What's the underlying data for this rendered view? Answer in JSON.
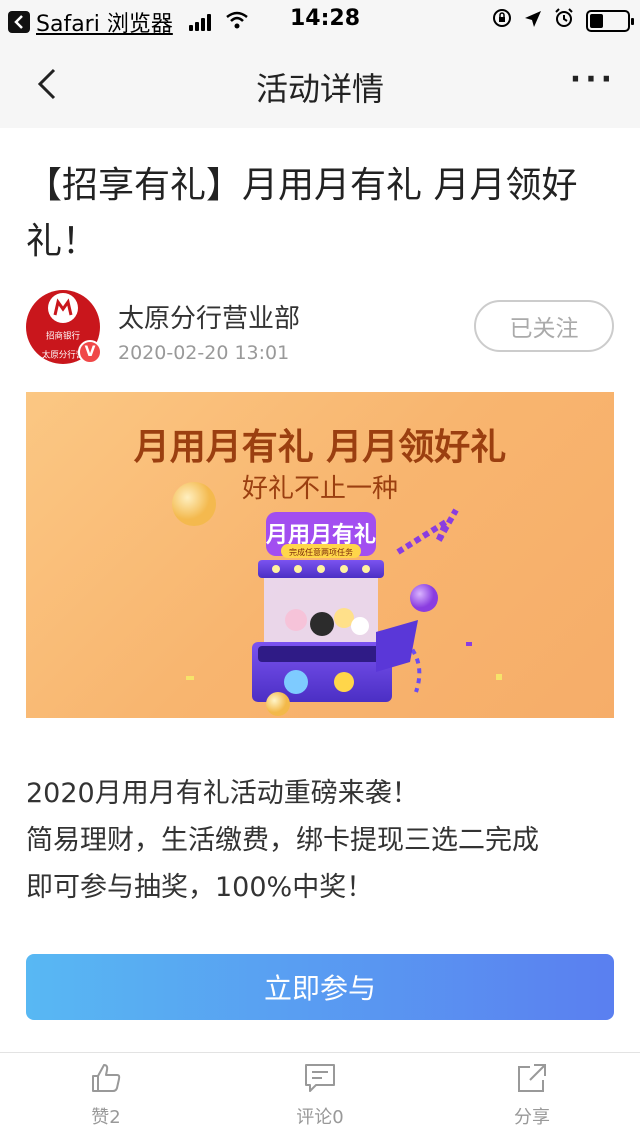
{
  "status_bar": {
    "back_app": "Safari 浏览器",
    "time": "14:28",
    "battery_level_percent": 35
  },
  "nav": {
    "title": "活动详情",
    "more": "···"
  },
  "article": {
    "title": "【招享有礼】月用月有礼 月月领好礼！",
    "author": {
      "name": "太原分行营业部",
      "time": "2020-02-20 13:01",
      "avatar_badge": "招商银行",
      "avatar_sub": "太原分行营",
      "verified_mark": "V"
    },
    "follow_label": "已关注",
    "banner": {
      "title": "月用月有礼 月月领好礼",
      "subtitle": "好礼不止一种",
      "machine_label": "月用月有礼",
      "machine_sub": "完成任意两项任务"
    },
    "description_lines": [
      "2020月用月有礼活动重磅来袭！",
      "简易理财，生活缴费，绑卡提现三选二完成",
      "即可参与抽奖，100%中奖！"
    ],
    "cta_label": "立即参与"
  },
  "toolbar": {
    "like_label": "赞2",
    "comment_label": "评论0",
    "share_label": "分享"
  },
  "colors": {
    "cta_start": "#58b8f3",
    "cta_end": "#5a7ff0",
    "avatar_red": "#c9161c",
    "banner_text": "#9b3f10"
  }
}
